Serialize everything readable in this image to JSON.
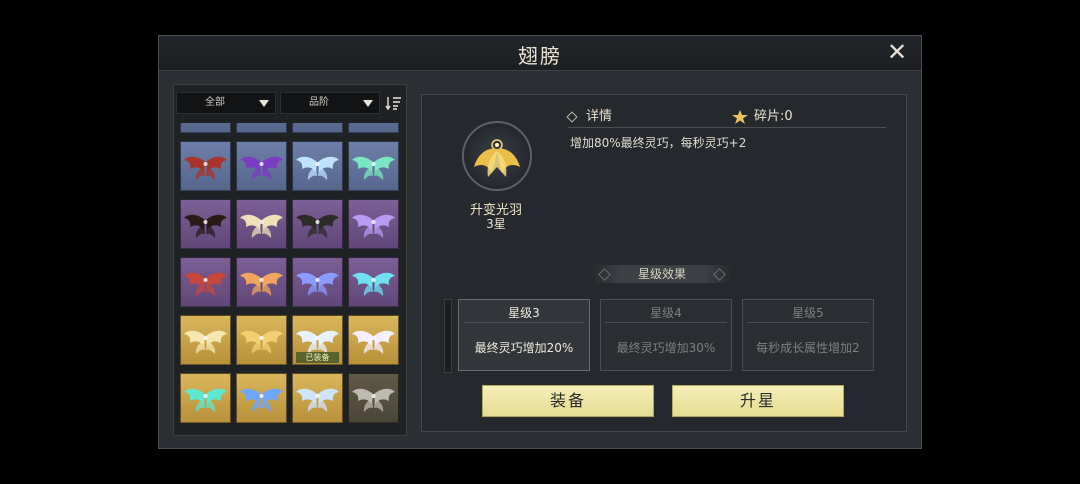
{
  "title": "翅膀",
  "filters": {
    "category": "全部",
    "quality": "品阶"
  },
  "grid": {
    "rows": [
      [
        {
          "tier": "blue"
        },
        {
          "tier": "blue"
        },
        {
          "tier": "blue"
        },
        {
          "tier": "blue"
        }
      ],
      [
        {
          "tier": "blue",
          "wing": "#a8342c"
        },
        {
          "tier": "blue",
          "wing": "#7a3cc0"
        },
        {
          "tier": "blue",
          "wing": "#bfe2ff"
        },
        {
          "tier": "blue",
          "wing": "#7be6c4"
        }
      ],
      [
        {
          "tier": "purple",
          "wing": "#2a1a18"
        },
        {
          "tier": "purple",
          "wing": "#efe0b8"
        },
        {
          "tier": "purple",
          "wing": "#2d2a2a"
        },
        {
          "tier": "purple",
          "wing": "#b89cf2"
        }
      ],
      [
        {
          "tier": "purple",
          "wing": "#c8463a"
        },
        {
          "tier": "purple",
          "wing": "#f0a65c"
        },
        {
          "tier": "purple",
          "wing": "#8a9cff"
        },
        {
          "tier": "purple",
          "wing": "#6ee0f0"
        }
      ],
      [
        {
          "tier": "gold",
          "wing": "#f6e7b0"
        },
        {
          "tier": "gold",
          "wing": "#f2d070"
        },
        {
          "tier": "gold",
          "wing": "#e8f2ff",
          "equipped": true
        },
        {
          "tier": "gold",
          "wing": "#f4f0ff"
        }
      ],
      [
        {
          "tier": "gold",
          "wing": "#5ee8d0"
        },
        {
          "tier": "gold",
          "wing": "#6ea6ff"
        },
        {
          "tier": "gold",
          "wing": "#cfe4ff"
        },
        {
          "tier": "locked",
          "wing": "#bdbab0"
        }
      ]
    ],
    "equipped_label": "已装备"
  },
  "detail": {
    "section_label": "详情",
    "shard_label": "碎片:0",
    "description": "增加80%最终灵巧，每秒灵巧+2",
    "item_name": "升变光羽",
    "item_star": "3星",
    "star_effect_title": "星级效果",
    "star_cards": [
      {
        "level": "星级3",
        "effect": "最终灵巧增加20%",
        "state": "active"
      },
      {
        "level": "星级4",
        "effect": "最终灵巧增加30%",
        "state": "dim"
      },
      {
        "level": "星级5",
        "effect": "每秒成长属性增加2",
        "state": "dim"
      }
    ],
    "equip_button": "装备",
    "upgrade_button": "升星"
  },
  "colors": {
    "button_bg": "#f0e8a8",
    "accent_gold": "#f2d070"
  }
}
